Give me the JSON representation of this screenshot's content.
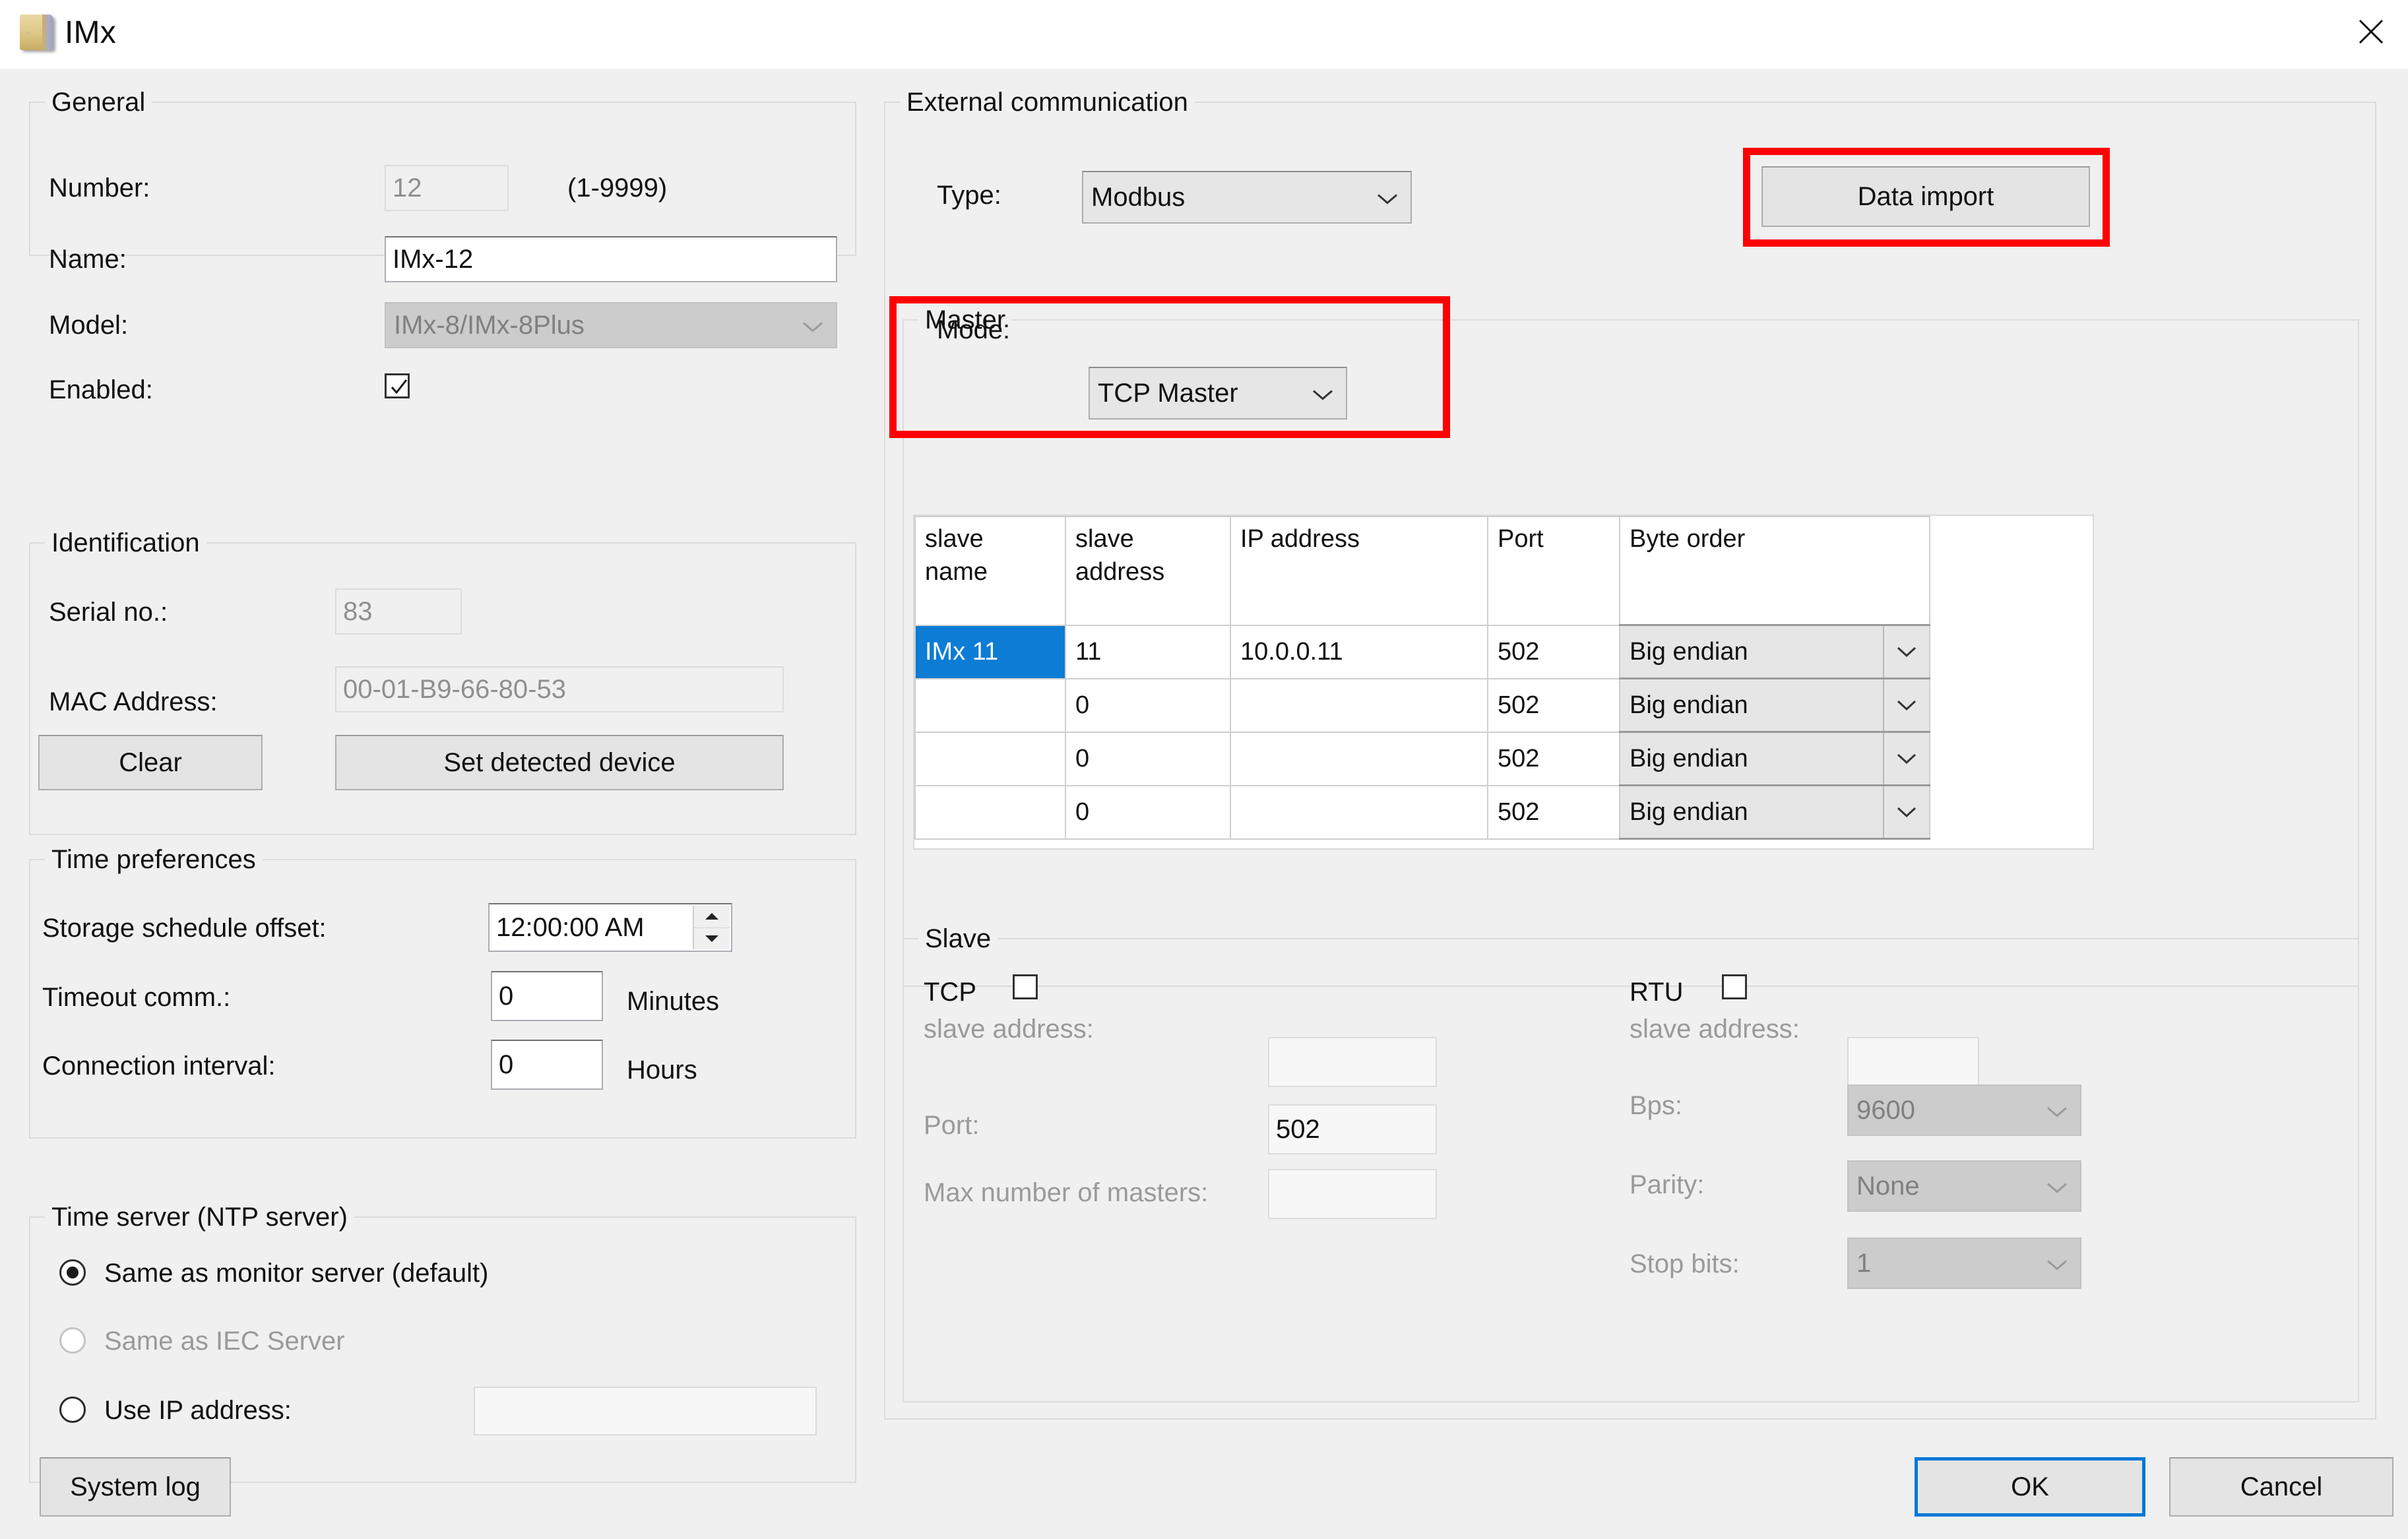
{
  "window": {
    "title": "IMx",
    "icon": "folder-icon",
    "close_icon": "close-icon"
  },
  "general": {
    "title": "General",
    "number_label": "Number:",
    "number_value": "12",
    "number_range_hint": "(1-9999)",
    "name_label": "Name:",
    "name_value": "IMx-12",
    "model_label": "Model:",
    "model_value": "IMx-8/IMx-8Plus",
    "enabled_label": "Enabled:",
    "enabled_checked": true
  },
  "identification": {
    "title": "Identification",
    "serial_label": "Serial no.:",
    "serial_value": "83",
    "mac_label": "MAC Address:",
    "mac_value": "00-01-B9-66-80-53",
    "clear_button": "Clear",
    "set_detected_button": "Set detected device"
  },
  "time_preferences": {
    "title": "Time preferences",
    "storage_offset_label": "Storage schedule offset:",
    "storage_offset_value": "12:00:00 AM",
    "timeout_label": "Timeout comm.:",
    "timeout_value": "0",
    "timeout_unit": "Minutes",
    "interval_label": "Connection interval:",
    "interval_value": "0",
    "interval_unit": "Hours"
  },
  "time_server": {
    "title": "Time server (NTP server)",
    "option_monitor": "Same as monitor server (default)",
    "option_iec": "Same as IEC Server",
    "option_ip": "Use IP address:",
    "ip_value": "",
    "selected": "option_monitor"
  },
  "external_communication": {
    "title": "External communication",
    "type_label": "Type:",
    "type_value": "Modbus",
    "data_import_button": "Data import",
    "master": {
      "title": "Master",
      "mode_label": "Mode:",
      "mode_value": "TCP Master"
    },
    "slave_table": {
      "columns": [
        "slave\nname",
        "slave\naddress",
        "IP address",
        "Port",
        "Byte order"
      ],
      "column_labels": {
        "name_line1": "slave",
        "name_line2": "name",
        "addr_line1": "slave",
        "addr_line2": "address",
        "ip": "IP address",
        "port": "Port",
        "byte_order": "Byte order"
      },
      "rows": [
        {
          "slave_name": "IMx 11",
          "slave_address": "11",
          "ip_address": "10.0.0.11",
          "port": "502",
          "byte_order": "Big endian",
          "selected": true
        },
        {
          "slave_name": "",
          "slave_address": "0",
          "ip_address": "",
          "port": "502",
          "byte_order": "Big endian",
          "selected": false
        },
        {
          "slave_name": "",
          "slave_address": "0",
          "ip_address": "",
          "port": "502",
          "byte_order": "Big endian",
          "selected": false
        },
        {
          "slave_name": "",
          "slave_address": "0",
          "ip_address": "",
          "port": "502",
          "byte_order": "Big endian",
          "selected": false
        }
      ]
    },
    "slave": {
      "title": "Slave",
      "tcp_label": "TCP",
      "tcp_checked": false,
      "rtu_label": "RTU",
      "rtu_checked": false,
      "tcp_slave_address_label": "slave address:",
      "tcp_slave_address_value": "",
      "tcp_port_label": "Port:",
      "tcp_port_value": "502",
      "tcp_max_masters_label": "Max number of masters:",
      "tcp_max_masters_value": "",
      "rtu_slave_address_label": "slave address:",
      "rtu_slave_address_value": "",
      "rtu_bps_label": "Bps:",
      "rtu_bps_value": "9600",
      "rtu_parity_label": "Parity:",
      "rtu_parity_value": "None",
      "rtu_stopbits_label": "Stop bits:",
      "rtu_stopbits_value": "1"
    }
  },
  "footer": {
    "system_log_button": "System log",
    "ok_button": "OK",
    "cancel_button": "Cancel"
  },
  "colors": {
    "accent": "#0078d7",
    "selection": "#0c7cd5",
    "highlight": "#ff0000",
    "dialog_bg": "#f0f0f0"
  }
}
